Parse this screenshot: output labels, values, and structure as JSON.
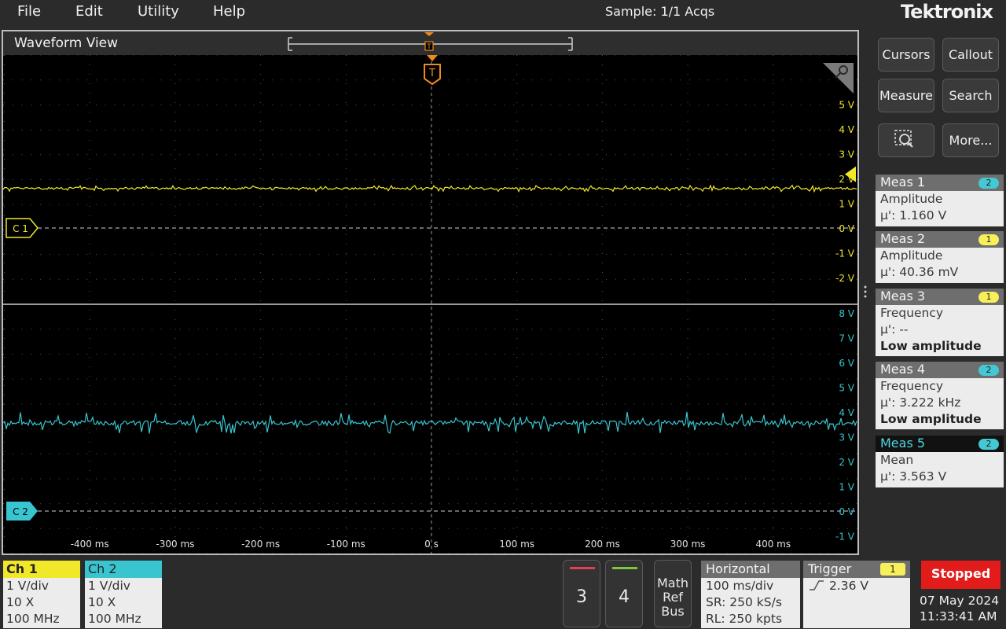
{
  "menu": {
    "file": "File",
    "edit": "Edit",
    "utility": "Utility",
    "help": "Help"
  },
  "acquisition_status": "Sample: 1/1 Acqs",
  "brand": "Tektronix",
  "waveform_view": {
    "title": "Waveform View",
    "trigger_marker": "T",
    "x_ticks": [
      "-400 ms",
      "-300 ms",
      "-200 ms",
      "-100 ms",
      "0 s",
      "100 ms",
      "200 ms",
      "300 ms",
      "400 ms"
    ],
    "ch1_scale_labels": [
      "5 V",
      "4 V",
      "3 V",
      "2 V",
      "1 V",
      "0 V",
      "-1 V",
      "-2 V"
    ],
    "ch2_scale_labels": [
      "8 V",
      "7 V",
      "6 V",
      "5 V",
      "4 V",
      "3 V",
      "2 V",
      "1 V",
      "0 V",
      "-1 V"
    ],
    "ch1_tag": "C 1",
    "ch2_tag": "C 2",
    "ch1_level_volts": 1.6,
    "ch2_level_volts": 3.56,
    "trigger_level_volts": 2.36,
    "colors": {
      "ch1": "#f2e82a",
      "ch2": "#38c5d0",
      "trigger": "#f08a1c",
      "grid": "#6a6a6a"
    }
  },
  "sidebar": {
    "cursors": "Cursors",
    "callout": "Callout",
    "measure": "Measure",
    "search": "Search",
    "more": "More...",
    "measurements": [
      {
        "name": "Meas 1",
        "badge": "2",
        "type": "Amplitude",
        "value": "μ': 1.160 V",
        "note": ""
      },
      {
        "name": "Meas 2",
        "badge": "1",
        "type": "Amplitude",
        "value": "μ': 40.36 mV",
        "note": ""
      },
      {
        "name": "Meas 3",
        "badge": "1",
        "type": "Frequency",
        "value": "μ': --",
        "note": "Low amplitude"
      },
      {
        "name": "Meas 4",
        "badge": "2",
        "type": "Frequency",
        "value": "μ': 3.222 kHz",
        "note": "Low amplitude"
      },
      {
        "name": "Meas 5",
        "badge": "2",
        "type": "Mean",
        "value": "μ': 3.563 V",
        "note": ""
      }
    ]
  },
  "bottom": {
    "ch1": {
      "label": "Ch 1",
      "scale": "1 V/div",
      "probe": "10 X",
      "bw": "100 MHz"
    },
    "ch2": {
      "label": "Ch 2",
      "scale": "1 V/div",
      "probe": "10 X",
      "bw": "100 MHz"
    },
    "ch3": "3",
    "ch4": "4",
    "math": "Math",
    "ref": "Ref",
    "bus": "Bus",
    "horizontal": {
      "label": "Horizontal",
      "scale": "100 ms/div",
      "sr": "SR: 250 kS/s",
      "rl": "RL: 250 kpts"
    },
    "trigger": {
      "label": "Trigger",
      "badge": "1",
      "level": "2.36 V"
    },
    "status": "Stopped",
    "date": "07 May 2024",
    "time": "11:33:41 AM"
  }
}
